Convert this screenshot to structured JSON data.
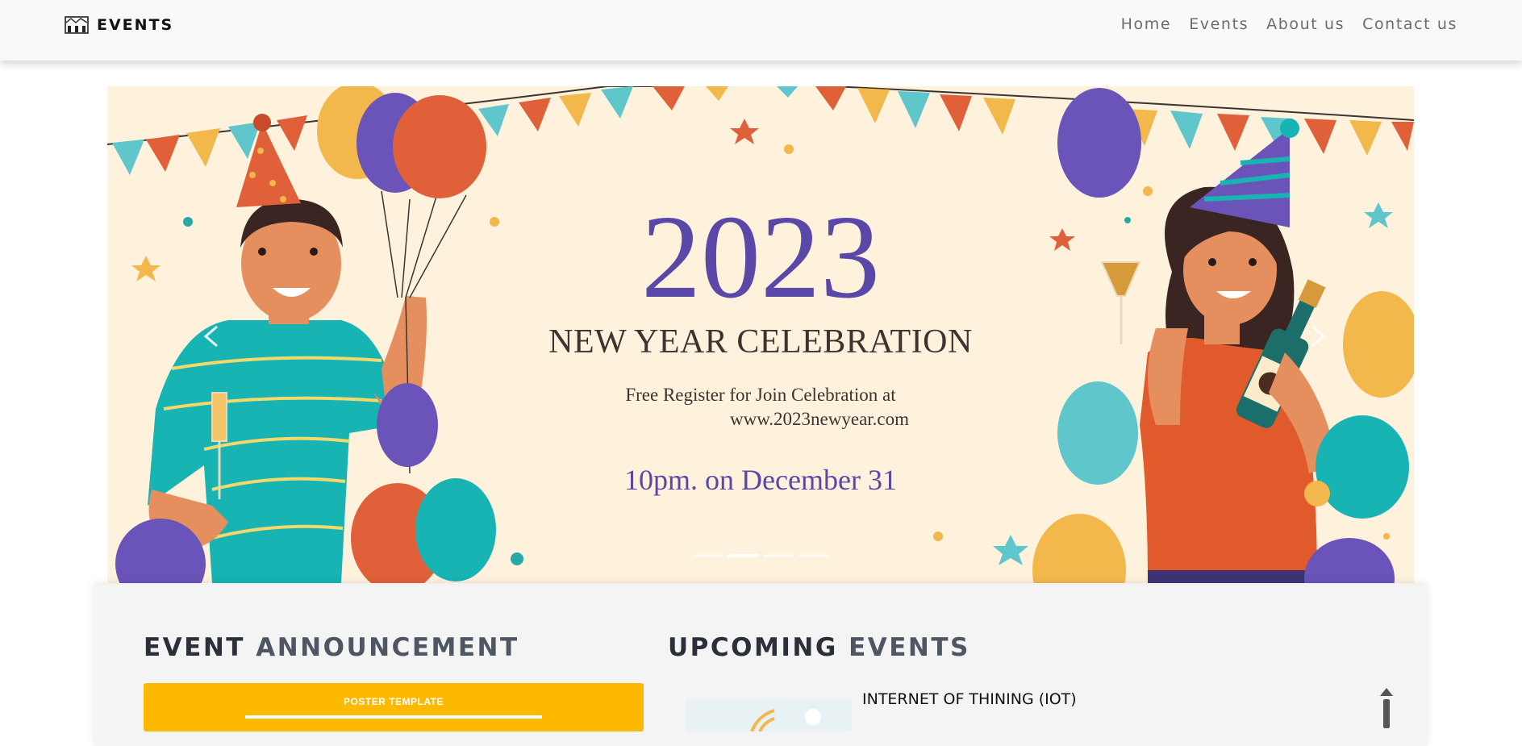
{
  "navbar": {
    "brand": "EVENTS",
    "brand_icon": "building-icon",
    "links": [
      {
        "label": "Home"
      },
      {
        "label": "Events"
      },
      {
        "label": "About us"
      },
      {
        "label": "Contact us"
      }
    ]
  },
  "hero": {
    "year": "2023",
    "title": "NEW YEAR CELEBRATION",
    "subtitle_line1": "Free Register for Join Celebration at",
    "subtitle_line2": "www.2023newyear.com",
    "date": "10pm. on December 31",
    "slide_count": 4,
    "active_slide": 2,
    "colors": {
      "background": "#fef2dd",
      "accent": "#5a48a8",
      "text": "#3b3431"
    }
  },
  "announcement": {
    "title_strong": "EVENT",
    "title_light": "ANNOUNCEMENT",
    "poster_label": "POSTER TEMPLATE",
    "poster_color": "#fdb900"
  },
  "upcoming": {
    "title_strong": "UPCOMING",
    "title_light": "EVENTS",
    "events": [
      {
        "name": "INTERNET OF THINING (IOT)"
      }
    ]
  }
}
